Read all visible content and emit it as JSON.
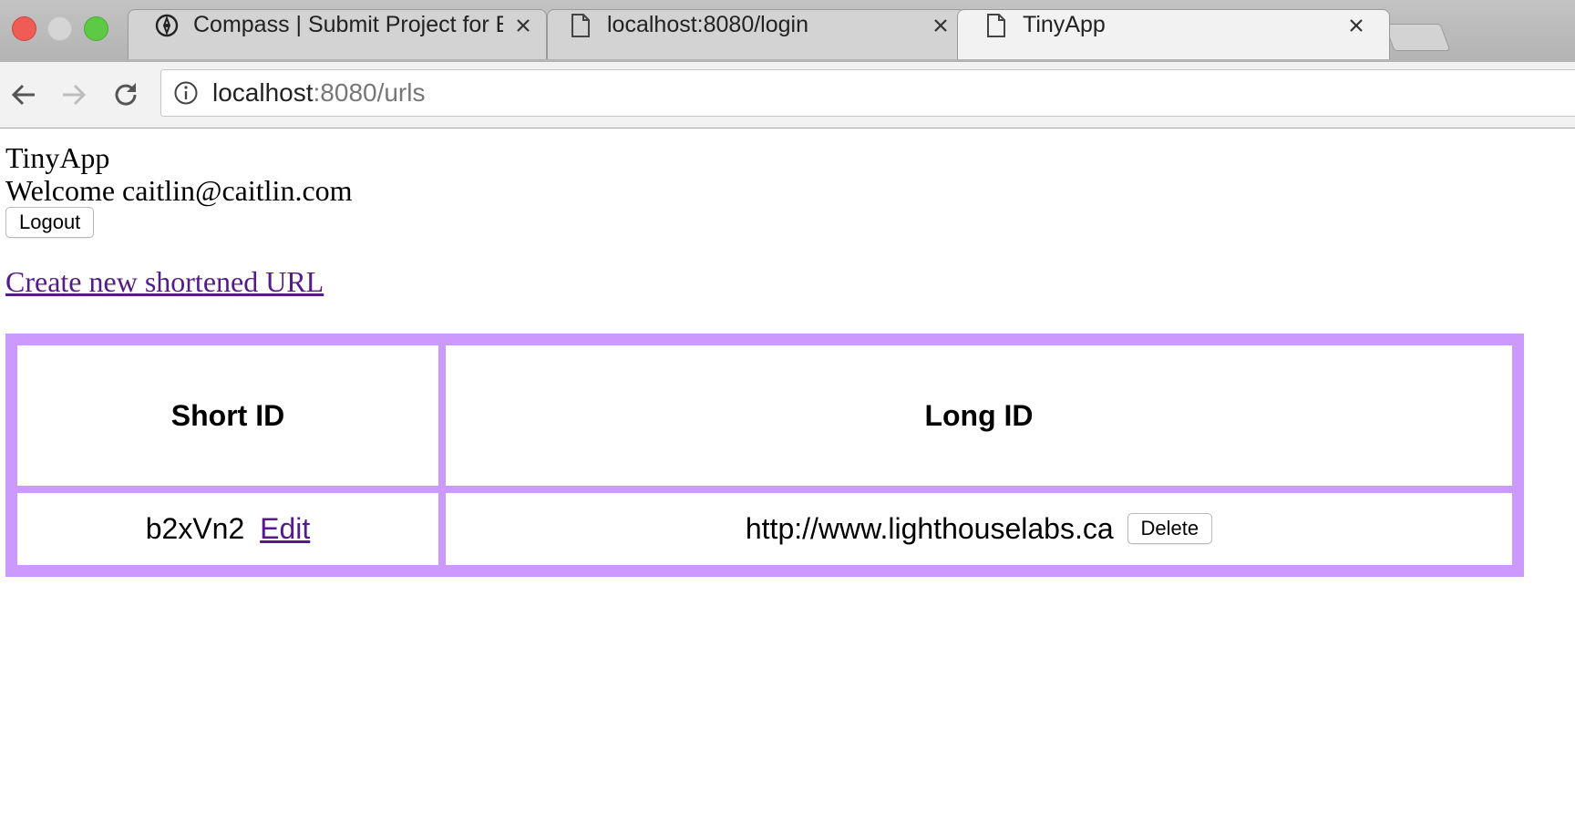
{
  "browser": {
    "tabs": [
      {
        "title": "Compass | Submit Project for E",
        "icon": "compass-icon",
        "active": false
      },
      {
        "title": "localhost:8080/login",
        "icon": "document-icon",
        "active": false
      },
      {
        "title": "TinyApp",
        "icon": "document-icon",
        "active": true
      }
    ],
    "address": {
      "host": "localhost",
      "path": ":8080/urls"
    }
  },
  "page": {
    "brand": "TinyApp",
    "welcome": "Welcome caitlin@caitlin.com",
    "logout_label": "Logout",
    "create_link": "Create new shortened URL",
    "table": {
      "headers": [
        "Short ID",
        "Long ID"
      ],
      "rows": [
        {
          "short_id": "b2xVn2",
          "edit_label": "Edit",
          "long_url": "http://www.lighthouselabs.ca",
          "delete_label": "Delete"
        }
      ],
      "border_color": "#cc99ff"
    },
    "link_color": "#551a8b"
  }
}
